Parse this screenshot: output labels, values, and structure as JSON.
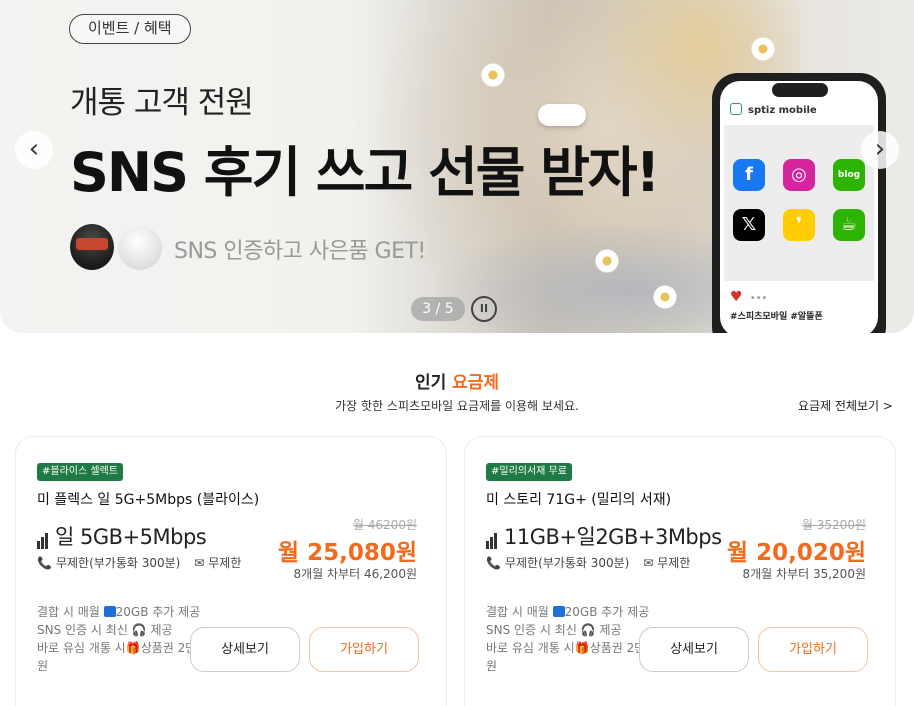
{
  "banner": {
    "tag": "이벤트 / 혜택",
    "subtitle": "개통 고객 전원",
    "title": "SNS 후기 쓰고 선물 받자!",
    "promo": "SNS 인증하고 사은품 GET!",
    "pager": "3 / 5",
    "prev_icon": "‹",
    "next_icon": "›",
    "pause_icon": "II",
    "phone": {
      "brand": "sptiz mobile",
      "tags": "#스피츠모바일 #알뜰폰",
      "dots": "•••",
      "heart": "♥",
      "apps": [
        {
          "name": "facebook-icon",
          "glyph": "f",
          "color": "#1877f2"
        },
        {
          "name": "instagram-icon",
          "glyph": "◎",
          "color": "#d6249f"
        },
        {
          "name": "blog-icon",
          "glyph": "blog",
          "color": "#2db400"
        },
        {
          "name": "x-icon",
          "glyph": "𝕏",
          "color": "#000000"
        },
        {
          "name": "kakaostory-icon",
          "glyph": "❜",
          "color": "#ffcd00"
        },
        {
          "name": "cafe-icon",
          "glyph": "☕",
          "color": "#2db400"
        }
      ]
    }
  },
  "section": {
    "title_plain": "인기 ",
    "title_accent": "요금제",
    "description": "가장 핫한 스피츠모바일 요금제를 이용해 보세요.",
    "view_all": "요금제 전체보기 >"
  },
  "plans": [
    {
      "badge": "#블라이스 셀렉트",
      "name": "미 플렉스 일 5G+5Mbps (블라이스)",
      "data": "일 5GB+5Mbps",
      "calls": "무제한(부가통화 300분)",
      "sms": "무제한",
      "old_price": "월 46200원",
      "price": "월 25,080원",
      "after": "8개월 차부터 46,200원",
      "benefit_a": "결합 시 매월 ",
      "benefit_b": "20GB 추가 제공",
      "benefit_c": "SNS 인증 시 최신 ",
      "benefit_d": " 제공",
      "benefit_e": "바로 유심 개통 시",
      "benefit_f": "상품권 2만원",
      "detail_btn": "상세보기",
      "join_btn": "가입하기"
    },
    {
      "badge": "#밀리의서재 무료",
      "name": "미 스토리 71G+ (밀리의 서재)",
      "data": "11GB+일2GB+3Mbps",
      "calls": "무제한(부가통화 300분)",
      "sms": "무제한",
      "old_price": "월 35200원",
      "price": "월 20,020원",
      "after": "8개월 차부터 35,200원",
      "benefit_a": "결합 시 매월 ",
      "benefit_b": "20GB 추가 제공",
      "benefit_c": "SNS 인증 시 최신 ",
      "benefit_d": " 제공",
      "benefit_e": "바로 유심 개통 시",
      "benefit_f": "상품권 2만원",
      "detail_btn": "상세보기",
      "join_btn": "가입하기"
    }
  ],
  "colors": {
    "accent": "#f26b1d",
    "badge": "#1f7a45"
  }
}
